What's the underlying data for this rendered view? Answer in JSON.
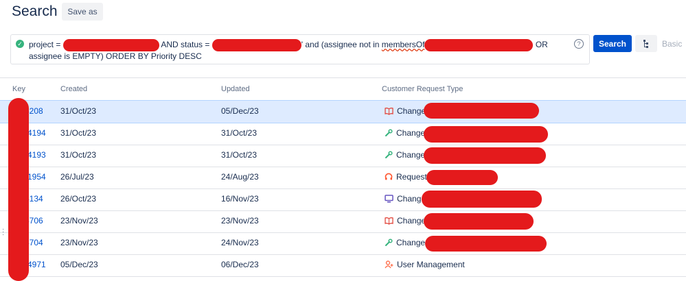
{
  "header": {
    "title": "Search",
    "save_as_label": "Save as"
  },
  "query": {
    "line1_part1": "project = ",
    "line1_part2": " AND status = ",
    "line1_part3": "' and (assignee not in ",
    "line1_squiggle": "membersOf",
    "line1_part4": " OR",
    "line2": "assignee is EMPTY) ORDER BY Priority DESC",
    "help_glyph": "?"
  },
  "toolbar": {
    "search_label": "Search",
    "basic_label": "Basic"
  },
  "table": {
    "columns": [
      "Key",
      "Created",
      "Updated",
      "Customer Request Type"
    ],
    "rows": [
      {
        "key": "4208",
        "created": "31/Oct/23",
        "updated": "05/Dec/23",
        "type": "Change",
        "icon": "book-icon"
      },
      {
        "key": "-4194",
        "created": "31/Oct/23",
        "updated": "31/Oct/23",
        "type": "Change",
        "icon": "wrench-icon"
      },
      {
        "key": "-4193",
        "created": "31/Oct/23",
        "updated": "31/Oct/23",
        "type": "Change",
        "icon": "wrench-icon"
      },
      {
        "key": "-1954",
        "created": "26/Jul/23",
        "updated": "24/Aug/23",
        "type": "Request",
        "icon": "lifebuoy-icon"
      },
      {
        "key": "4134",
        "created": "26/Oct/23",
        "updated": "16/Nov/23",
        "type": "Chang",
        "icon": "monitor-icon"
      },
      {
        "key": "4706",
        "created": "23/Nov/23",
        "updated": "23/Nov/23",
        "type": "Change",
        "icon": "book-icon"
      },
      {
        "key": "4704",
        "created": "23/Nov/23",
        "updated": "24/Nov/23",
        "type": "Change",
        "icon": "wrench-icon"
      },
      {
        "key": "-4971",
        "created": "05/Dec/23",
        "updated": "06/Dec/23",
        "type": "User Management",
        "icon": "user-add-icon"
      }
    ]
  },
  "colors": {
    "primary": "#0052cc",
    "selected_row": "#deebff",
    "redaction": "#e41a1c",
    "success": "#36b37e"
  }
}
